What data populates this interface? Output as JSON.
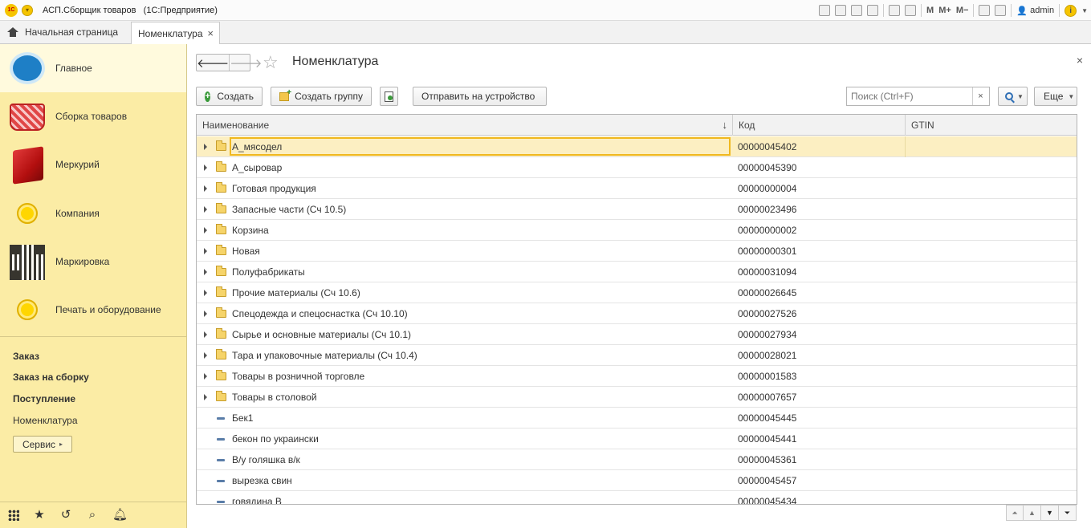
{
  "app": {
    "title": "АСП.Сборщик товаров",
    "platform": "(1С:Предприятие)",
    "logo_text": "1С",
    "user": "admin",
    "toolbar_m": "M",
    "toolbar_mplus": "M+",
    "toolbar_mminus": "M−"
  },
  "tabs": {
    "home": "Начальная страница",
    "active": "Номенклатура"
  },
  "sidebar": {
    "sections": [
      {
        "label": "Главное",
        "icon": "main-icon",
        "active": true
      },
      {
        "label": "Сборка товаров",
        "icon": "basket-icon"
      },
      {
        "label": "Меркурий",
        "icon": "cube-icon"
      },
      {
        "label": "Компания",
        "icon": "circle-icon"
      },
      {
        "label": "Маркировка",
        "icon": "qr-code-icon"
      },
      {
        "label": "Печать и оборудование",
        "icon": "circle-icon"
      }
    ],
    "links": [
      "Заказ",
      "Заказ на сборку",
      "Поступление",
      "Номенклатура"
    ],
    "service_button": "Сервис"
  },
  "form": {
    "title": "Номенклатура",
    "toolbar": {
      "create": "Создать",
      "create_group": "Создать группу",
      "send_to_device": "Отправить на устройство",
      "search_placeholder": "Поиск (Ctrl+F)",
      "more": "Еще"
    },
    "columns": {
      "name": "Наименование",
      "code": "Код",
      "gtin": "GTIN"
    },
    "rows": [
      {
        "name": "А_мясодел",
        "code": "00000045402",
        "type": "group",
        "selected": true
      },
      {
        "name": "А_сыровар",
        "code": "00000045390",
        "type": "group"
      },
      {
        "name": "Готовая продукция",
        "code": "00000000004",
        "type": "group"
      },
      {
        "name": "Запасные части (Сч 10.5)",
        "code": "00000023496",
        "type": "group"
      },
      {
        "name": "Корзина",
        "code": "00000000002",
        "type": "group"
      },
      {
        "name": "Новая",
        "code": "00000000301",
        "type": "group"
      },
      {
        "name": "Полуфабрикаты",
        "code": "00000031094",
        "type": "group"
      },
      {
        "name": "Прочие материалы (Сч 10.6)",
        "code": "00000026645",
        "type": "group"
      },
      {
        "name": "Спецодежда и спецоснастка (Сч 10.10)",
        "code": "00000027526",
        "type": "group"
      },
      {
        "name": "Сырье и основные материалы (Сч 10.1)",
        "code": "00000027934",
        "type": "group"
      },
      {
        "name": "Тара и упаковочные материалы (Сч 10.4)",
        "code": "00000028021",
        "type": "group"
      },
      {
        "name": "Товары в розничной торговле",
        "code": "00000001583",
        "type": "group"
      },
      {
        "name": "Товары в столовой",
        "code": "00000007657",
        "type": "group"
      },
      {
        "name": "Бек1",
        "code": "00000045445",
        "type": "item"
      },
      {
        "name": "бекон по украински",
        "code": "00000045441",
        "type": "item"
      },
      {
        "name": "В/у голяшка в/к",
        "code": "00000045361",
        "type": "item"
      },
      {
        "name": "вырезка свин",
        "code": "00000045457",
        "type": "item"
      },
      {
        "name": "говядина В",
        "code": "00000045434",
        "type": "item"
      }
    ]
  },
  "colors": {
    "sidebar_bg": "#fbeca5",
    "selected_row": "#fcefc2",
    "selection_border": "#f0b820"
  }
}
